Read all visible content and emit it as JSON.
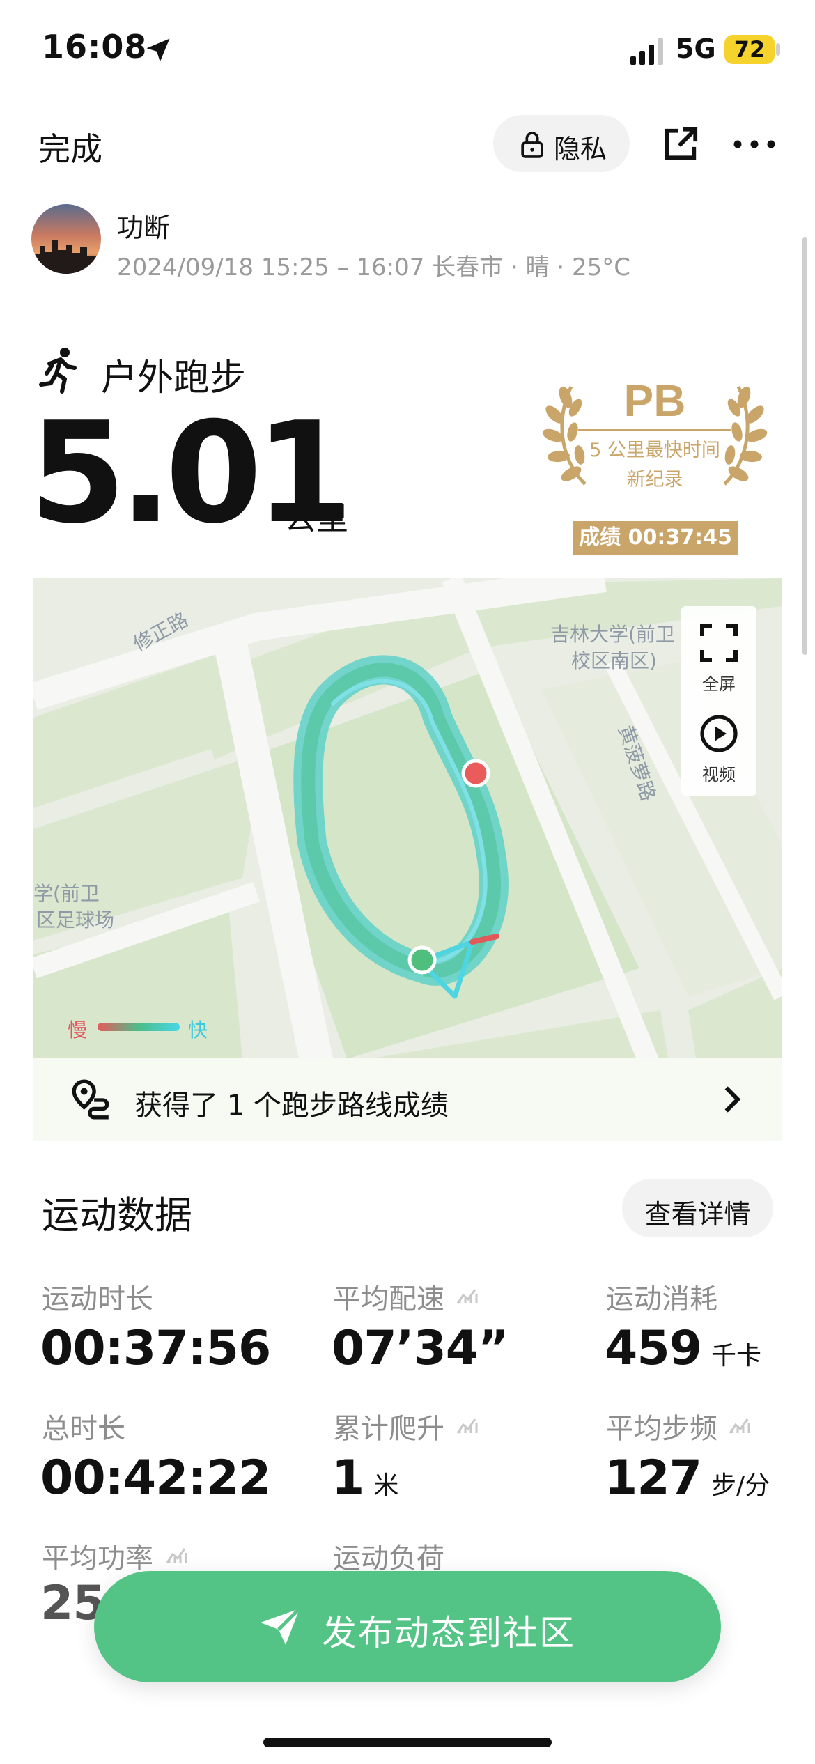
{
  "status_bar": {
    "time": "16:08",
    "network": "5G",
    "battery": "72"
  },
  "header": {
    "done_label": "完成",
    "privacy_label": "隐私"
  },
  "user": {
    "name": "功断",
    "meta": "2024/09/18 15:25 – 16:07 长春市 · 晴 · 25°C"
  },
  "activity": {
    "type": "户外跑步",
    "distance": "5.01",
    "unit": "公里"
  },
  "pb_badge": {
    "title": "PB",
    "line1": "5 公里最快时间",
    "line2": "新纪录",
    "score": "成绩 00:37:45"
  },
  "map": {
    "labels": {
      "road1": "修正路",
      "campus": [
        "吉林大学(前卫",
        "校区南区)"
      ],
      "road2": "黄菠萝路",
      "field": [
        "学(前卫",
        "区足球场"
      ]
    },
    "fullscreen_label": "全屏",
    "video_label": "视频",
    "legend_slow": "慢",
    "legend_fast": "快"
  },
  "route_banner": {
    "text": "获得了 1 个跑步路线成绩"
  },
  "section": {
    "title": "运动数据",
    "detail_button": "查看详情"
  },
  "metrics": [
    {
      "label": "运动时长",
      "value": "00:37:56",
      "unit": ""
    },
    {
      "label": "平均配速",
      "value": "07’34”",
      "unit": ""
    },
    {
      "label": "运动消耗",
      "value": "459",
      "unit": "千卡"
    },
    {
      "label": "总时长",
      "value": "00:42:22",
      "unit": ""
    },
    {
      "label": "累计爬升",
      "value": "1",
      "unit": "米"
    },
    {
      "label": "平均步频",
      "value": "127",
      "unit": "步/分"
    },
    {
      "label": "平均功率",
      "value": "25",
      "unit": ""
    },
    {
      "label": "运动负荷",
      "value": "",
      "unit": ""
    }
  ],
  "post_button": {
    "label": "发布动态到社区"
  },
  "colors": {
    "accent_green": "#53c486",
    "pb_gold": "#c9a56a",
    "battery_yellow": "#f5d32c"
  }
}
